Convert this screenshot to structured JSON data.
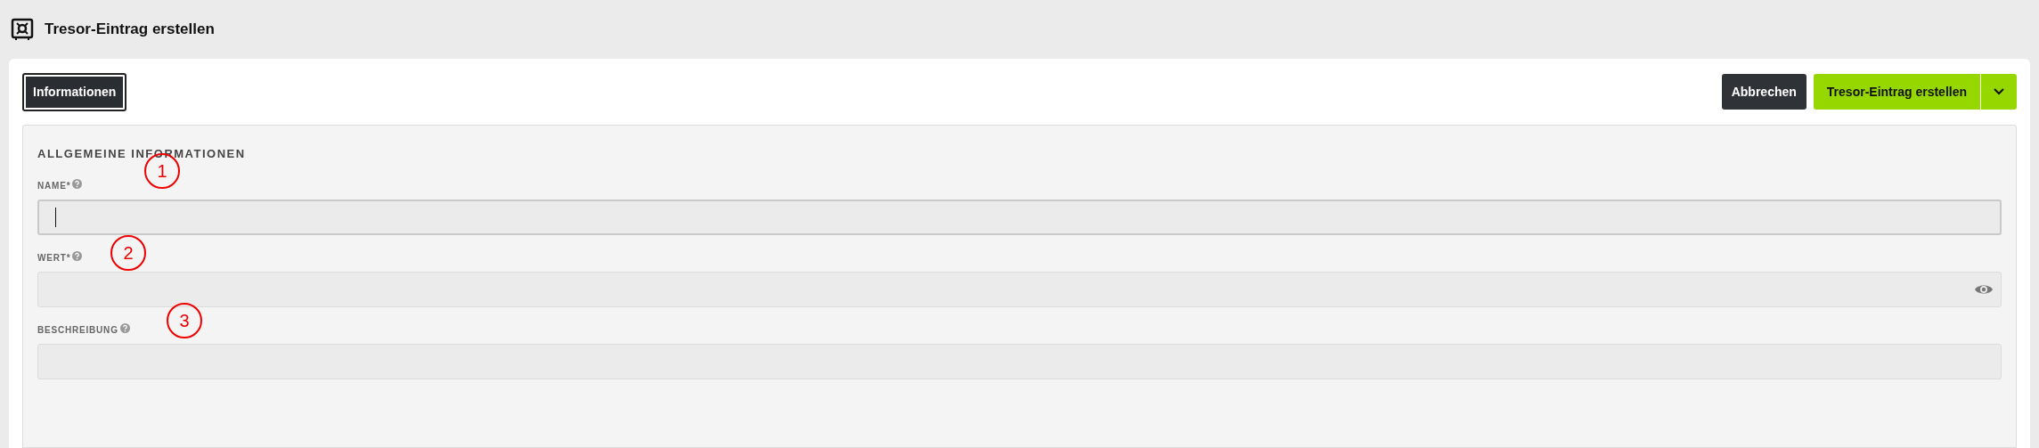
{
  "page_title": "Tresor-Eintrag erstellen",
  "tabs": [
    {
      "label": "Informationen",
      "selected": true
    }
  ],
  "actions": {
    "cancel": "Abbrechen",
    "submit": "Tresor-Eintrag erstellen"
  },
  "section": {
    "title": "ALLGEMEINE INFORMATIONEN",
    "fields": [
      {
        "label": "NAME*",
        "kind": "text",
        "focused": true
      },
      {
        "label": "WERT*",
        "kind": "password",
        "focused": false
      },
      {
        "label": "BESCHREIBUNG",
        "kind": "text",
        "focused": false
      }
    ]
  },
  "annotations": [
    "1",
    "2",
    "3"
  ]
}
